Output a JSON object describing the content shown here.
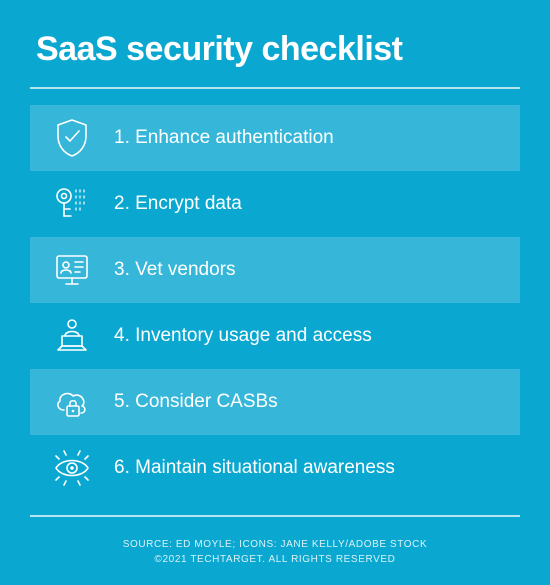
{
  "title": "SaaS security checklist",
  "items": {
    "i1": "1. Enhance authentication",
    "i2": "2. Encrypt data",
    "i3": "3. Vet vendors",
    "i4": "4. Inventory usage and access",
    "i5": "5. Consider CASBs",
    "i6": "6. Maintain situational awareness"
  },
  "footer": {
    "line1": "SOURCE: ED MOYLE; ICONS: JANE KELLY/ADOBE STOCK",
    "line2": "©2021 TECHTARGET. ALL RIGHTS RESERVED"
  }
}
